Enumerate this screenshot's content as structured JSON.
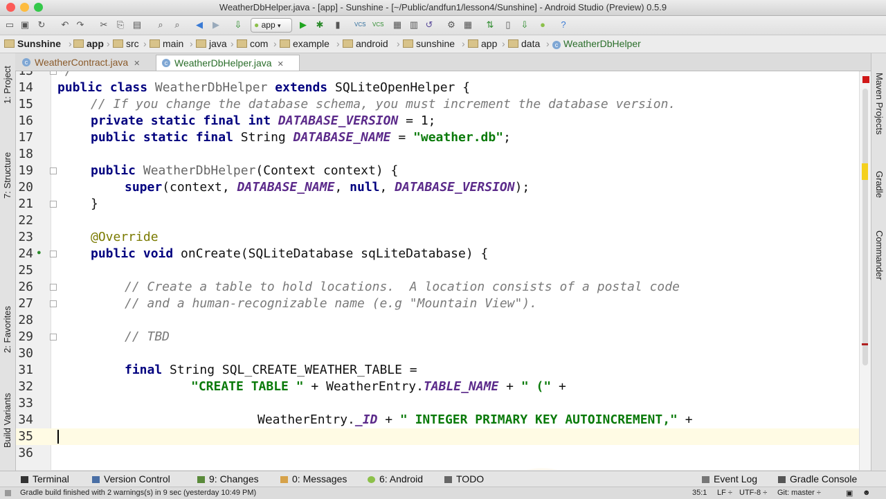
{
  "window": {
    "title": "WeatherDbHelper.java - [app] - Sunshine - [~/Public/andfun1/lesson4/Sunshine] - Android Studio (Preview) 0.5.9",
    "traffic_colors": {
      "close": "#fc5b57",
      "minimize": "#fdbc40",
      "zoom": "#34c84a"
    }
  },
  "toolbar": {
    "run_config": "app",
    "icons": [
      "open-icon",
      "save-icon",
      "sync-icon",
      "undo-icon",
      "redo-icon",
      "cut-icon",
      "copy-icon",
      "paste-icon",
      "find-icon",
      "replace-icon",
      "back-icon",
      "forward-icon",
      "make-icon",
      "run-icon",
      "debug-icon",
      "attach-icon",
      "vcs-update-icon",
      "vcs-commit-icon",
      "diff-icon",
      "revert-icon",
      "settings-icon",
      "structure-icon",
      "sync-gradle-icon",
      "avd-icon",
      "sdk-icon",
      "monitor-icon",
      "help-icon"
    ]
  },
  "breadcrumb": [
    "Sunshine",
    "app",
    "src",
    "main",
    "java",
    "com",
    "example",
    "android",
    "sunshine",
    "app",
    "data",
    "WeatherDbHelper"
  ],
  "tabs": [
    {
      "label": "WeatherContract.java",
      "active": false
    },
    {
      "label": "WeatherDbHelper.java",
      "active": true
    }
  ],
  "left_tools": [
    "1: Project",
    "7: Structure",
    "2: Favorites",
    "Build Variants"
  ],
  "right_tools": [
    "Maven Projects",
    "Gradle",
    "Commander"
  ],
  "code_lines": [
    {
      "n": "13",
      "fold": true
    },
    {
      "n": "14"
    },
    {
      "n": "15"
    },
    {
      "n": "16"
    },
    {
      "n": "17"
    },
    {
      "n": "18"
    },
    {
      "n": "19",
      "fold": true
    },
    {
      "n": "20"
    },
    {
      "n": "21",
      "fold": true
    },
    {
      "n": "22"
    },
    {
      "n": "23"
    },
    {
      "n": "24",
      "fold": true
    },
    {
      "n": "25"
    },
    {
      "n": "26",
      "fold": true
    },
    {
      "n": "27",
      "fold": true
    },
    {
      "n": "28"
    },
    {
      "n": "29",
      "fold": true
    },
    {
      "n": "30"
    },
    {
      "n": "31"
    },
    {
      "n": "32"
    },
    {
      "n": "33"
    },
    {
      "n": "34"
    },
    {
      "n": "35",
      "current": true
    },
    {
      "n": "36"
    }
  ],
  "code": {
    "l13": "*/",
    "l14": {
      "a": "public class",
      "b": " WeatherDbHelper ",
      "c": "extends",
      "d": " SQLiteOpenHelper {"
    },
    "l15": "// If you change the database schema, you must increment the database version.",
    "l16": {
      "a": "private static final int",
      "b": " DATABASE_VERSION",
      "c": " = 1;"
    },
    "l17": {
      "a": "public static final",
      "b": " String ",
      "c": "DATABASE_NAME",
      "d": " = ",
      "e": "\"weather.db\"",
      "f": ";"
    },
    "l19": {
      "a": "public",
      "b": " WeatherDbHelper",
      "c": "(Context context) {"
    },
    "l20": {
      "a": "super",
      "b": "(context, ",
      "c": "DATABASE_NAME",
      "d": ", ",
      "e": "null",
      "f": ", ",
      "g": "DATABASE_VERSION",
      "h": ");"
    },
    "l21": "}",
    "l23": "@Override",
    "l24": {
      "a": "public void",
      "b": " onCreate(SQLiteDatabase sqLiteDatabase) {"
    },
    "l26": "// Create a table to hold locations.  A location consists of a postal code",
    "l27": "// and a human-recognizable name (e.g \"Mountain View\").",
    "l29": "// TBD",
    "l31": {
      "a": "final",
      "b": " String SQL_CREATE_WEATHER_TABLE ="
    },
    "l32": {
      "a": "\"CREATE TABLE \"",
      "b": " + WeatherEntry.",
      "c": "TABLE_NAME",
      "d": " + ",
      "e": "\" (\"",
      "f": " +"
    },
    "l34": {
      "a": "WeatherEntry.",
      "b": "_ID",
      "c": " + ",
      "d": "\" INTEGER PRIMARY KEY AUTOINCREMENT,\"",
      "e": " +"
    }
  },
  "bottom_tools": [
    {
      "label": "Terminal",
      "icon": "terminal-icon"
    },
    {
      "label": "Version Control",
      "icon": "vcs-icon"
    },
    {
      "label": "9: Changes",
      "icon": "changes-icon"
    },
    {
      "label": "0: Messages",
      "icon": "messages-icon"
    },
    {
      "label": "6: Android",
      "icon": "android-icon"
    },
    {
      "label": "TODO",
      "icon": "todo-icon"
    },
    {
      "label": "Event Log",
      "icon": "event-log-icon"
    },
    {
      "label": "Gradle Console",
      "icon": "gradle-console-icon"
    }
  ],
  "status": {
    "message": "Gradle build finished with 2 warnings(s) in 9 sec (yesterday 10:49 PM)",
    "position": "35:1",
    "line_sep": "LF ÷",
    "encoding": "UTF-8 ÷",
    "vcs": "Git: master ÷"
  }
}
